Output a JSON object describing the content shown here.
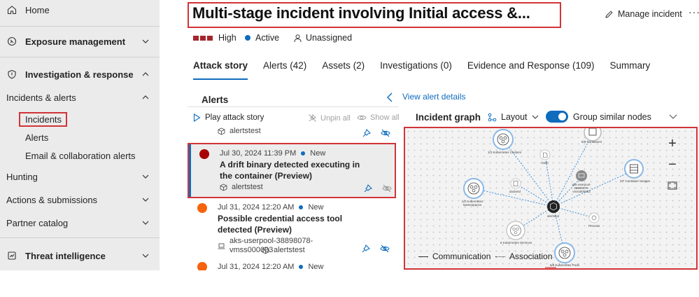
{
  "sidebar": {
    "home": "Home",
    "exposure": "Exposure management",
    "investigation": "Investigation & response",
    "incidents_alerts": "Incidents & alerts",
    "incidents": "Incidents",
    "alerts": "Alerts",
    "email_alerts": "Email & collaboration alerts",
    "hunting": "Hunting",
    "actions": "Actions & submissions",
    "partner": "Partner catalog",
    "threat_intel": "Threat intelligence"
  },
  "header": {
    "title": "Multi-stage incident involving Initial access &...",
    "manage": "Manage incident",
    "more": "···",
    "severity": "High",
    "status": "Active",
    "assignee": "Unassigned"
  },
  "tabs": [
    "Attack story",
    "Alerts (42)",
    "Assets (2)",
    "Investigations (0)",
    "Evidence and Response (109)",
    "Summary"
  ],
  "alerts_panel": {
    "heading": "Alerts",
    "play": "Play attack story",
    "unpin": "Unpin all",
    "show_all": "Show all",
    "top_entity": "alertstest",
    "items": [
      {
        "date": "Jul 30, 2024 11:39 PM",
        "status": "New",
        "title": "A drift binary detected executing in the container (Preview)",
        "entity": "alertstest",
        "color": "#a80000"
      },
      {
        "date": "Jul 31, 2024 12:20 AM",
        "status": "New",
        "title": "Possible credential access tool detected (Preview)",
        "entity_vm": "aks-userpool-38898078-vmss000003",
        "entity": "alertstest",
        "color": "#f7630c"
      },
      {
        "date": "Jul 31, 2024 12:20 AM",
        "status": "New",
        "color": "#f7630c"
      }
    ]
  },
  "graph": {
    "view_details": "View alert details",
    "title": "Incident graph",
    "layout": "Layout",
    "group": "Group similar nodes",
    "zoom_in": "+",
    "zoom_out": "−",
    "legend_comm": "Communication",
    "legend_assoc": "Association",
    "node_labels": {
      "clusters": "1/2 Kubernetes Clusters",
      "containers": "5/9 Containers",
      "bash": "bash",
      "docker": "dockerd",
      "vm": "aks-userpool-38898078-vmss000003",
      "images": "2/7 Container Images",
      "namespaces": "1/2 Kubernetes Namespaces",
      "center": "alertsbot",
      "process": "Process",
      "services": "6 Kubernetes Services",
      "pods": "5/9 Kubernetes Pods"
    }
  }
}
